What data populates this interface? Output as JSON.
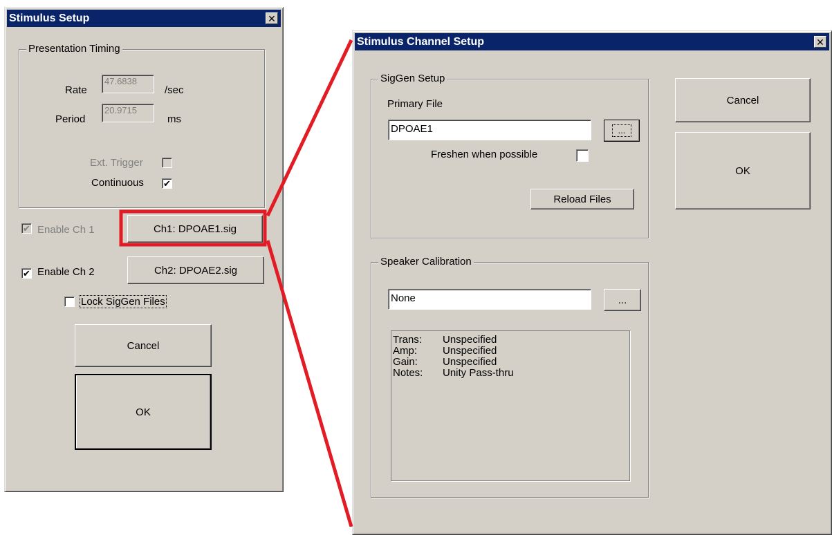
{
  "left_dialog": {
    "title": "Stimulus Setup",
    "close_label": "✕",
    "timing_group": {
      "label": "Presentation Timing",
      "rate_label": "Rate",
      "rate_value": "47.6838",
      "rate_unit": "/sec",
      "period_label": "Period",
      "period_value": "20.9715",
      "period_unit": "ms",
      "ext_trigger_label": "Ext. Trigger",
      "ext_trigger_checked": false,
      "continuous_label": "Continuous",
      "continuous_checked": true
    },
    "enable_ch1_label": "Enable Ch 1",
    "enable_ch1_checked": true,
    "ch1_button": "Ch1: DPOAE1.sig",
    "enable_ch2_label": "Enable Ch 2",
    "enable_ch2_checked": true,
    "ch2_button": "Ch2: DPOAE2.sig",
    "lock_label": "Lock SigGen Files",
    "lock_checked": false,
    "cancel_label": "Cancel",
    "ok_label": "OK"
  },
  "right_dialog": {
    "title": "Stimulus Channel Setup",
    "close_label": "✕",
    "siggen_group": {
      "label": "SigGen Setup",
      "primary_file_label": "Primary File",
      "primary_file_value": "DPOAE1",
      "browse_label": "...",
      "freshen_label": "Freshen when possible",
      "freshen_checked": false,
      "reload_label": "Reload Files"
    },
    "speaker_group": {
      "label": "Speaker Calibration",
      "calibration_value": "None",
      "browse_label": "...",
      "info": [
        {
          "key": "Trans:",
          "value": "Unspecified"
        },
        {
          "key": "Amp:",
          "value": "Unspecified"
        },
        {
          "key": "Gain:",
          "value": "Unspecified"
        },
        {
          "key": "Notes:",
          "value": "Unity Pass-thru"
        }
      ]
    },
    "cancel_label": "Cancel",
    "ok_label": "OK"
  },
  "check_mark": "✔",
  "colors": {
    "dialog_face": "#d4d0c8",
    "title_bar": "#0a246a",
    "highlight_annotation": "#e21c24"
  }
}
